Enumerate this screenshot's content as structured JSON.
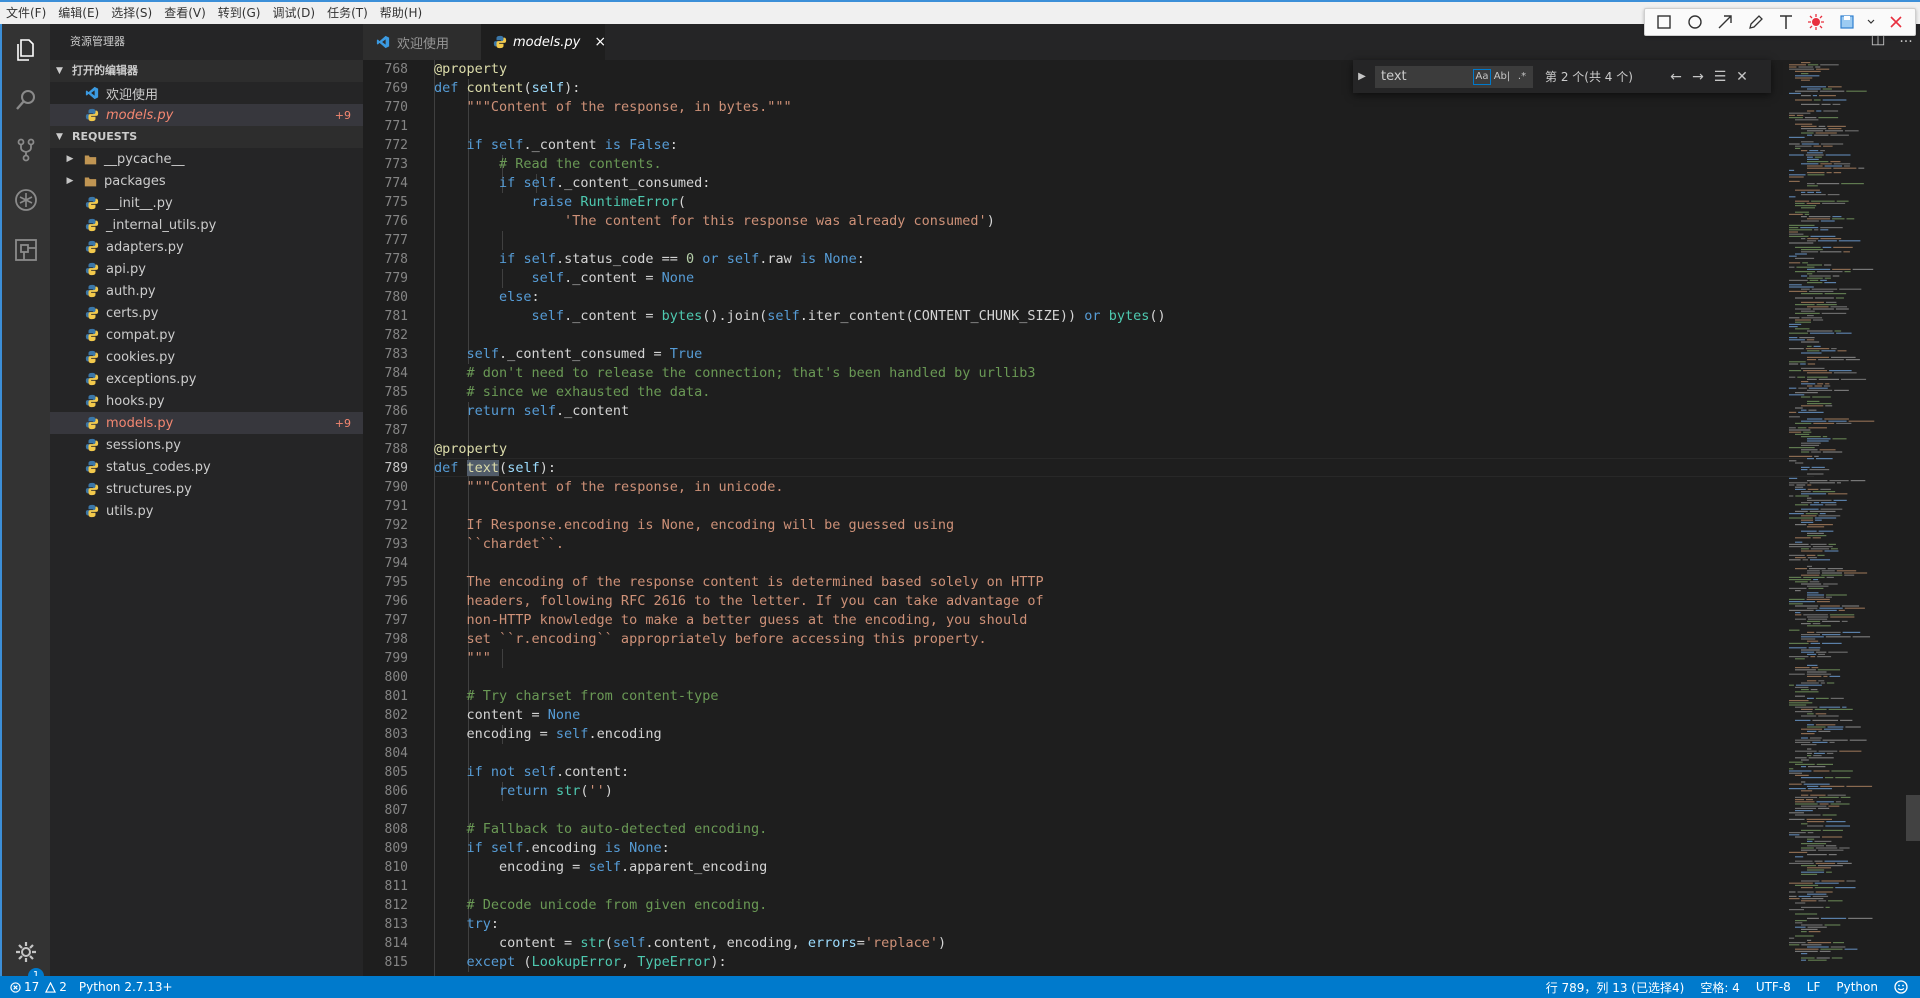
{
  "menu": [
    "文件(F)",
    "编辑(E)",
    "选择(S)",
    "查看(V)",
    "转到(G)",
    "调试(D)",
    "任务(T)",
    "帮助(H)"
  ],
  "sidebar": {
    "title": "资源管理器",
    "open_editors_label": "打开的编辑器",
    "open_editors": [
      {
        "label": "欢迎使用",
        "icon": "vscode-icon"
      },
      {
        "label": "models.py",
        "icon": "python-icon",
        "count": "+9"
      }
    ],
    "folder_label": "REQUESTS",
    "folders": [
      "__pycache__",
      "packages"
    ],
    "files": [
      {
        "label": "__init__.py"
      },
      {
        "label": "_internal_utils.py"
      },
      {
        "label": "adapters.py"
      },
      {
        "label": "api.py"
      },
      {
        "label": "auth.py"
      },
      {
        "label": "certs.py"
      },
      {
        "label": "compat.py"
      },
      {
        "label": "cookies.py"
      },
      {
        "label": "exceptions.py"
      },
      {
        "label": "hooks.py"
      },
      {
        "label": "models.py",
        "count": "+9"
      },
      {
        "label": "sessions.py"
      },
      {
        "label": "status_codes.py"
      },
      {
        "label": "structures.py"
      },
      {
        "label": "utils.py"
      }
    ]
  },
  "tabs": [
    {
      "label": "欢迎使用",
      "icon": "vscode-icon"
    },
    {
      "label": "models.py",
      "icon": "python-icon",
      "close": "×"
    }
  ],
  "find": {
    "value": "text",
    "opt_case": "Aa",
    "opt_word": "Ab|",
    "opt_regex": ".*",
    "result": "第 2 个(共 4 个)"
  },
  "editor": {
    "line_numbers": [
      "768",
      "769",
      "770",
      "771",
      "772",
      "773",
      "774",
      "775",
      "776",
      "777",
      "778",
      "779",
      "780",
      "781",
      "782",
      "783",
      "784",
      "785",
      "786",
      "787",
      "788",
      "789",
      "790",
      "791",
      "792",
      "793",
      "794",
      "795",
      "796",
      "797",
      "798",
      "799",
      "800",
      "801",
      "802",
      "803",
      "804",
      "805",
      "806",
      "807",
      "808",
      "809",
      "810",
      "811",
      "812",
      "813",
      "814",
      "815"
    ],
    "current_line": "789"
  },
  "status": {
    "errors": "17",
    "warnings": "2",
    "interpreter": "Python 2.7.13+",
    "position": "行 789，列 13 (已选择4)",
    "spaces": "空格: 4",
    "encoding": "UTF-8",
    "eol": "LF",
    "language": "Python"
  },
  "activity_badge": "1",
  "colors": {
    "accent": "#007acc",
    "modified": "#f48771"
  }
}
